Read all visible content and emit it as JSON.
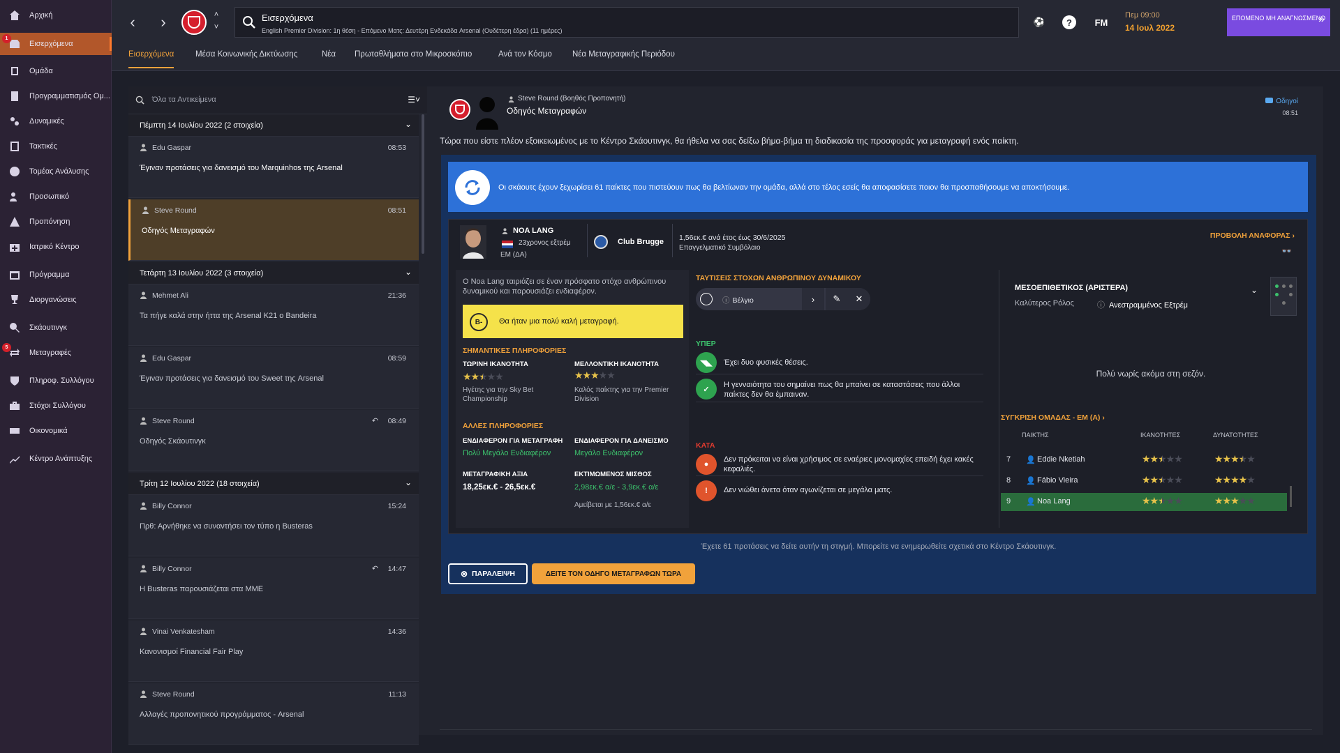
{
  "sidebar": {
    "items": [
      {
        "label": "Αρχική",
        "icon": "home-icon"
      },
      {
        "label": "Εισερχόμενα",
        "icon": "inbox-icon",
        "badge": "1"
      },
      {
        "label": "Ομάδα",
        "icon": "squad-icon"
      },
      {
        "label": "Προγραμματισμός Ομ...",
        "icon": "planning-icon"
      },
      {
        "label": "Δυναμικές",
        "icon": "dynamics-icon"
      },
      {
        "label": "Τακτικές",
        "icon": "tactics-icon"
      },
      {
        "label": "Τομέας Ανάλυσης",
        "icon": "analysis-icon"
      },
      {
        "label": "Προσωπικό",
        "icon": "staff-icon"
      },
      {
        "label": "Προπόνηση",
        "icon": "training-icon"
      },
      {
        "label": "Ιατρικό Κέντρο",
        "icon": "medical-icon"
      },
      {
        "label": "Πρόγραμμα",
        "icon": "schedule-icon"
      },
      {
        "label": "Διοργανώσεις",
        "icon": "trophy-icon"
      },
      {
        "label": "Σκάουτινγκ",
        "icon": "scouting-icon"
      },
      {
        "label": "Μεταγραφές",
        "icon": "transfers-icon",
        "badge": "5"
      },
      {
        "label": "Πληροφ. Συλλόγου",
        "icon": "club-info-icon"
      },
      {
        "label": "Στόχοι Συλλόγου",
        "icon": "club-vision-icon"
      },
      {
        "label": "Οικονομικά",
        "icon": "finances-icon"
      },
      {
        "label": "Κέντρο Ανάπτυξης",
        "icon": "development-icon"
      }
    ]
  },
  "topbar": {
    "title": "Εισερχόμενα",
    "subtitle": "English Premier Division: 1η θέση - Επόμενο Ματς: Δευτέρη Ενδεκάδα Arsenal (Ουδέτερη έδρα) (11 ημέρες)",
    "fm_label": "FM",
    "help_label": "?",
    "time": "Πεμ 09:00",
    "date": "14 Ιουλ 2022",
    "continue_label": "ΕΠΟΜΕΝΟ ΜΗ ΑΝΑΓΝΩΣΜΕΝΟ"
  },
  "tabs": [
    "Εισερχόμενα",
    "Μέσα Κοινωνικής Δικτύωσης",
    "Νέα",
    "Πρωταθλήματα στο Μικροσκόπιο",
    "Ανά τον Κόσμο",
    "Νέα Μεταγραφικής Περιόδου"
  ],
  "inbox": {
    "search_placeholder": "Όλα τα Αντικείμενα",
    "groups": [
      {
        "header": "Πέμπτη 14 Ιουλίου 2022 (2 στοιχεία)"
      },
      {
        "header": "Τετάρτη 13 Ιουλίου 2022 (3 στοιχεία)"
      },
      {
        "header": "Τρίτη 12 Ιουλίου 2022 (18 στοιχεία)"
      }
    ],
    "messages": [
      {
        "sender": "Edu Gaspar",
        "time": "08:53",
        "subject": "Έγιναν προτάσεις για δανεισμό του Marquinhos της Arsenal"
      },
      {
        "sender": "Steve Round",
        "time": "08:51",
        "subject": "Οδηγός Μεταγραφών"
      },
      {
        "sender": "Mehmet Ali",
        "time": "21:36",
        "subject": "Τα πήγε καλά στην ήττα της Arsenal K21 ο Bandeira"
      },
      {
        "sender": "Edu Gaspar",
        "time": "08:59",
        "subject": "Έγιναν προτάσεις για δανεισμό του Sweet της Arsenal"
      },
      {
        "sender": "Steve Round",
        "time": "08:49",
        "subject": "Οδηγός Σκάουτινγκ"
      },
      {
        "sender": "Billy Connor",
        "time": "15:24",
        "subject": "Πρθ: Αρνήθηκε να συναντήσει τον τύπο η Busteras"
      },
      {
        "sender": "Billy Connor",
        "time": "14:47",
        "subject": "Η Busteras παρουσιάζεται στα ΜΜΕ"
      },
      {
        "sender": "Vinai Venkatesham",
        "time": "14:36",
        "subject": "Κανονισμοί Financial Fair Play"
      },
      {
        "sender": "Steve Round",
        "time": "11:13",
        "subject": "Αλλαγές προπονητικού προγράμματος - Arsenal"
      }
    ]
  },
  "message": {
    "from": "Steve Round  (Βοηθός Προπονητή)",
    "title": "Οδηγός Μεταγραφών",
    "tag": "Οδηγοί",
    "time": "08:51",
    "intro": "Τώρα που είστε πλέον εξοικειωμένος με το Κέντρο Σκάουτινγκ, θα ήθελα να σας δείξω βήμα-βήμα τη διαδικασία της προσφοράς για μεταγραφή ενός παίκτη.",
    "banner": "Οι σκάουτς έχουν ξεχωρίσει 61 παίκτες που πιστεύουν πως θα βελτίωναν την ομάδα, αλλά στο τέλος εσείς θα αποφασίσετε ποιον θα προσπαθήσουμε να αποκτήσουμε.",
    "player": {
      "name": "NOA LANG",
      "age": "23χρονος εξτρέμ",
      "position": "ΕΜ (ΔΑ)",
      "club": "Club Brugge",
      "contract": "1,56εκ.€ ανά έτος έως 30/6/2025",
      "contract_type": "Επαγγελματικό Συμβόλαιο",
      "report_link": "ΠΡΟΒΟΛΗ ΑΝΑΦΟΡΑΣ",
      "description": "Ο Noa Lang ταιριάζει σε έναν πρόσφατο στόχο ανθρώπινου δυναμικού και παρουσιάζει ενδιαφέρον.",
      "grade": "B-",
      "verdict": "Θα ήταν μια πολύ καλή μεταγραφή.",
      "key_info_h": "ΣΗΜΑΝΤΙΚΕΣ ΠΛΗΡΟΦΟΡΙΕΣ",
      "current_ability_h": "ΤΩΡΙΝΗ ΙΚΑΝΟΤΗΤΑ",
      "potential_ability_h": "ΜΕΛΛΟΝΤΙΚΗ ΙΚΑΝΟΤΗΤΑ",
      "current_stars": 2.5,
      "potential_stars": 3,
      "current_note": "Ηγέτης για την Sky Bet Championship",
      "potential_note": "Καλός παίκτης για την Premier Division",
      "other_info_h": "ΑΛΛΕΣ ΠΛΗΡΟΦΟΡΙΕΣ",
      "transfer_interest_h": "ΕΝΔΙΑΦΕΡΟΝ ΓΙΑ ΜΕΤΑΓΡΑΦΗ",
      "loan_interest_h": "ΕΝΔΙΑΦΕΡΟΝ ΓΙΑ ΔΑΝΕΙΣΜΟ",
      "transfer_interest": "Πολύ Μεγάλο Ενδιαφέρον",
      "loan_interest": "Μεγάλο Ενδιαφέρον",
      "value_h": "ΜΕΤΑΓΡΑΦΙΚΗ ΑΞΙΑ",
      "wage_h": "ΕΚΤΙΜΩΜΕΝΟΣ ΜΙΣΘΟΣ",
      "value": "18,25εκ.€ - 26,5εκ.€",
      "wage": "2,98εκ.€ α/ε - 3,9εκ.€ α/ε",
      "wage_note": "Αμείβεται με 1,56εκ.€ α/ε"
    },
    "targets": {
      "header": "ΤΑΥΤΙΣΕΙΣ ΣΤΟΧΩΝ ΑΝΘΡΩΠΙΝΟΥ ΔΥΝΑΜΙΚΟΥ",
      "selected": "Βέλγιο",
      "pros_h": "ΥΠΕΡ",
      "pros": [
        "Έχει δυο φυσικές θέσεις.",
        "Η γενναιότητα του σημαίνει πως θα μπαίνει σε καταστάσεις που άλλοι παίκτες δεν θα έμπαιναν."
      ],
      "cons_h": "ΚΑΤΑ",
      "cons": [
        "Δεν πρόκειται να είναι χρήσιμος σε εναέριες μονομαχίες επειδή έχει κακές κεφαλιές.",
        "Δεν νιώθει άνετα όταν αγωνίζεται σε μεγάλα ματς."
      ]
    },
    "role": {
      "header": "ΜΕΣΟΕΠΙΘΕΤΙΚΟΣ (ΑΡΙΣΤΕΡΑ)",
      "best_label": "Καλύτερος Ρόλος",
      "best": "Ανεστραμμένος Εξτρέμ",
      "early": "Πολύ νωρίς ακόμα στη σεζόν.",
      "compare_h": "ΣΥΓΚΡΙΣΗ ΟΜΑΔΑΣ - ΕΜ (Α)",
      "col_player": "ΠΑΙΚΤΗΣ",
      "col_ability": "ΙΚΑΝΟΤΗΤΕΣ",
      "col_potential": "ΔΥΝΑΤΟΤΗΤΕΣ",
      "rows": [
        {
          "n": "7",
          "name": "Eddie Nketiah",
          "ability": 2.5,
          "potential": 3.5
        },
        {
          "n": "8",
          "name": "Fábio Vieira",
          "ability": 2.5,
          "potential": 4
        },
        {
          "n": "9",
          "name": "Noa Lang",
          "ability": 2.5,
          "potential": 3
        }
      ]
    },
    "footer_note": "Έχετε 61 προτάσεις να δείτε αυτήν τη στιγμή. Μπορείτε να ενημερωθείτε σχετικά στο Κέντρο Σκάουτινγκ.",
    "skip_label": "ΠΑΡΑΛΕΙΨΗ",
    "go_label": "ΔΕΙΤΕ ΤΟΝ ΟΔΗΓΟ ΜΕΤΑΓΡΑΦΩΝ ΤΩΡΑ"
  },
  "colors": {
    "accent": "#f1a23b",
    "selected_nav": "#b2572a",
    "banner_blue": "#2d71d8",
    "positive": "#3cc16c",
    "negative": "#e03b2f",
    "continue": "#7a4be0"
  }
}
